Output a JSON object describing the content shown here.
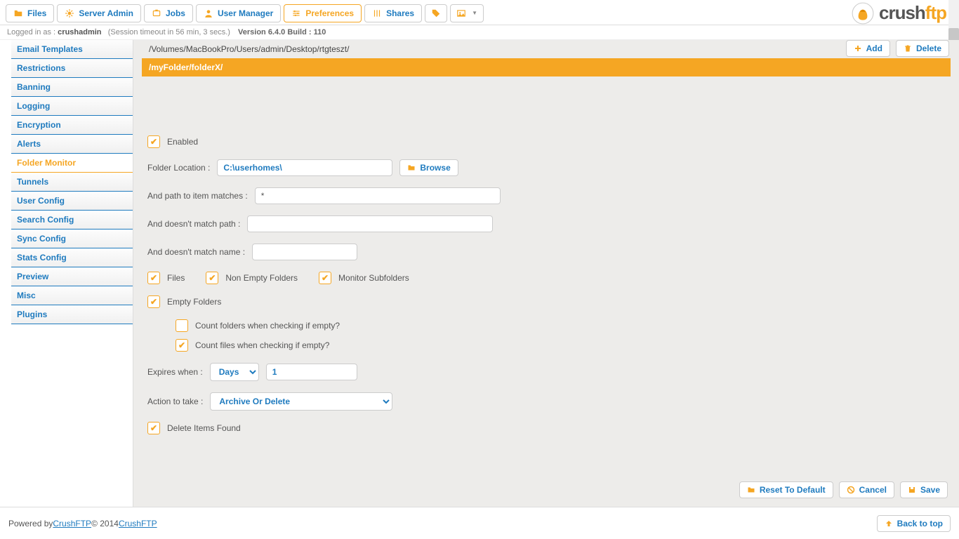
{
  "tabs": {
    "files": "Files",
    "serverAdmin": "Server Admin",
    "jobs": "Jobs",
    "userManager": "User Manager",
    "preferences": "Preferences",
    "shares": "Shares"
  },
  "status": {
    "prefix": "Logged in as : ",
    "user": "crushadmin",
    "session": "(Session timeout in 56 min, 3 secs.)",
    "version": "Version 6.4.0 Build : 110"
  },
  "logo": {
    "text1": "crush",
    "text2": "ftp"
  },
  "sidebar": {
    "items": [
      "Email Templates",
      "Restrictions",
      "Banning",
      "Logging",
      "Encryption",
      "Alerts",
      "Folder Monitor",
      "Tunnels",
      "User Config",
      "Search Config",
      "Sync Config",
      "Stats Config",
      "Preview",
      "Misc",
      "Plugins"
    ],
    "activeIndex": 6
  },
  "actions": {
    "add": "Add",
    "delete": "Delete",
    "browse": "Browse",
    "reset": "Reset To Default",
    "cancel": "Cancel",
    "save": "Save",
    "backTop": "Back to top"
  },
  "folderList": {
    "items": [
      {
        "path": "/Volumes/MacBookPro/Users/admin/Desktop/rtgteszt/",
        "selected": false
      },
      {
        "path": "/myFolder/folderX/",
        "selected": true
      }
    ]
  },
  "form": {
    "enabled": {
      "label": "Enabled",
      "checked": true
    },
    "folderLocation": {
      "label": "Folder Location :",
      "value": "C:\\userhomes\\"
    },
    "pathMatch": {
      "label": "And path to item matches :",
      "value": "*"
    },
    "notMatchPath": {
      "label": "And doesn't match path :",
      "value": ""
    },
    "notMatchName": {
      "label": "And doesn't match name :",
      "value": ""
    },
    "filesChk": {
      "label": "Files",
      "checked": true
    },
    "nonEmpty": {
      "label": "Non Empty Folders",
      "checked": true
    },
    "monitorSub": {
      "label": "Monitor Subfolders",
      "checked": true
    },
    "emptyFolders": {
      "label": "Empty Folders",
      "checked": true
    },
    "countFolders": {
      "label": "Count folders when checking if empty?",
      "checked": false
    },
    "countFiles": {
      "label": "Count files when checking if empty?",
      "checked": true
    },
    "expires": {
      "label": "Expires when :",
      "unit": "Days",
      "value": "1"
    },
    "action": {
      "label": "Action to take :",
      "value": "Archive Or Delete"
    },
    "deleteItems": {
      "label": "Delete Items Found",
      "checked": true
    }
  },
  "footer": {
    "poweredBy": "Powered by ",
    "link1": "CrushFTP",
    "mid": " © 2014 ",
    "link2": "CrushFTP"
  }
}
